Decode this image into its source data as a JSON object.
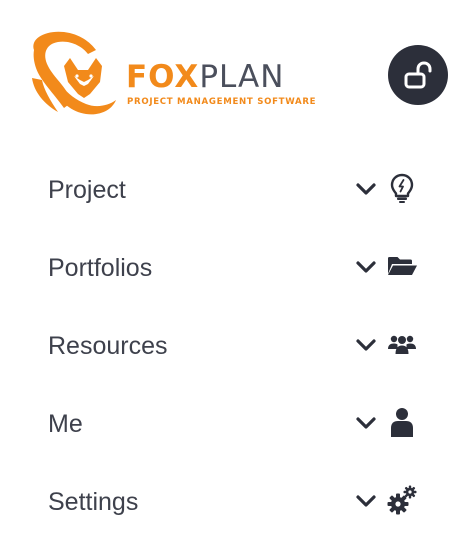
{
  "app": {
    "brand_part1": "FOX",
    "brand_part2": "PLAN",
    "tagline": "PROJECT MANAGEMENT SOFTWARE"
  },
  "colors": {
    "brand_orange": "#f28a1b",
    "text_dark": "#3e414c",
    "icon_dark": "#2c2f3a"
  },
  "header": {
    "lock_icon": "lock-open-icon"
  },
  "menu": {
    "items": [
      {
        "label": "Project",
        "icon": "lightbulb-icon"
      },
      {
        "label": "Portfolios",
        "icon": "folder-open-icon"
      },
      {
        "label": "Resources",
        "icon": "users-icon"
      },
      {
        "label": "Me",
        "icon": "user-icon"
      },
      {
        "label": "Settings",
        "icon": "gears-icon"
      }
    ]
  }
}
